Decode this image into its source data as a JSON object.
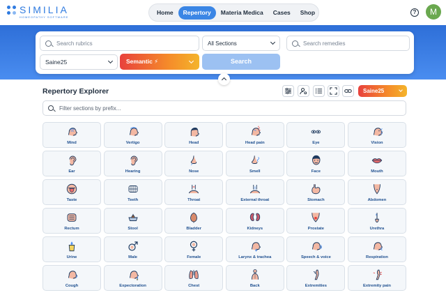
{
  "app": {
    "logo_word": "SIMILIA",
    "logo_sub": "HOMEOPATHY SOFTWARE",
    "avatar_letter": "M"
  },
  "nav": [
    {
      "label": "Home",
      "active": false
    },
    {
      "label": "Repertory",
      "active": true
    },
    {
      "label": "Materia Medica",
      "active": false
    },
    {
      "label": "Cases",
      "active": false
    },
    {
      "label": "Shop",
      "active": false
    }
  ],
  "search": {
    "rubrics_placeholder": "Search rubrics",
    "sections_value": "All Sections",
    "remedies_placeholder": "Search remedies",
    "repertory_value": "Saine25",
    "mode_label": "Semantic",
    "search_button": "Search"
  },
  "explorer": {
    "title": "Repertory Explorer",
    "repertory_badge": "Saine25",
    "filter_placeholder": "Filter sections by prefix...",
    "sections": [
      {
        "label": "Mind",
        "icon": "head-brain"
      },
      {
        "label": "Vertigo",
        "icon": "dizzy-head"
      },
      {
        "label": "Head",
        "icon": "head"
      },
      {
        "label": "Head pain",
        "icon": "head-pain"
      },
      {
        "label": "Eye",
        "icon": "eyes"
      },
      {
        "label": "Vision",
        "icon": "vision-head"
      },
      {
        "label": "Ear",
        "icon": "ear"
      },
      {
        "label": "Hearing",
        "icon": "ear"
      },
      {
        "label": "Nose",
        "icon": "nose"
      },
      {
        "label": "Smell",
        "icon": "smell"
      },
      {
        "label": "Face",
        "icon": "face"
      },
      {
        "label": "Mouth",
        "icon": "lips"
      },
      {
        "label": "Taste",
        "icon": "tongue"
      },
      {
        "label": "Teeth",
        "icon": "teeth"
      },
      {
        "label": "Throat",
        "icon": "throat"
      },
      {
        "label": "External throat",
        "icon": "neck"
      },
      {
        "label": "Stomach",
        "icon": "stomach"
      },
      {
        "label": "Abdomen",
        "icon": "abdomen"
      },
      {
        "label": "Rectum",
        "icon": "intestine"
      },
      {
        "label": "Stool",
        "icon": "stool"
      },
      {
        "label": "Bladder",
        "icon": "bladder"
      },
      {
        "label": "Kidneys",
        "icon": "kidneys"
      },
      {
        "label": "Prostate",
        "icon": "prostate"
      },
      {
        "label": "Urethra",
        "icon": "urethra"
      },
      {
        "label": "Urine",
        "icon": "urine"
      },
      {
        "label": "Male",
        "icon": "male"
      },
      {
        "label": "Female",
        "icon": "female"
      },
      {
        "label": "Larynx & trachea",
        "icon": "larynx"
      },
      {
        "label": "Speech & voice",
        "icon": "speech"
      },
      {
        "label": "Respiration",
        "icon": "respiration"
      },
      {
        "label": "Cough",
        "icon": "cough"
      },
      {
        "label": "Expectoration",
        "icon": "expectoration"
      },
      {
        "label": "Chest",
        "icon": "chest"
      },
      {
        "label": "Back",
        "icon": "back"
      },
      {
        "label": "Extremities",
        "icon": "extremities"
      },
      {
        "label": "Extremity pain",
        "icon": "extremity-pain"
      }
    ]
  },
  "colors": {
    "accent": "#3b86e5",
    "band": "#2e6fd8",
    "tile_label": "#1e4f8f",
    "icon_dark": "#1e3a5f",
    "icon_fill": "#f3b8a3"
  }
}
